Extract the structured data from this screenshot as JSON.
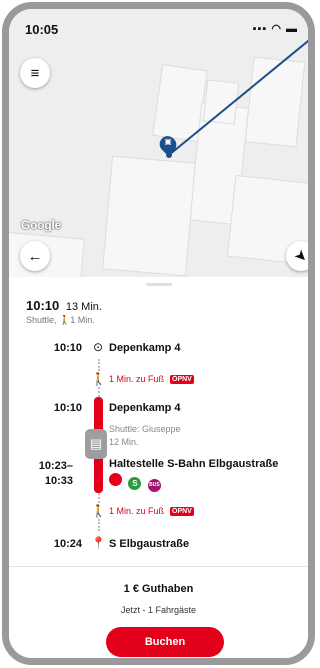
{
  "status": {
    "time": "10:05",
    "icons": "▪▪▪ ◠ ▬"
  },
  "map": {
    "attribution": "Google"
  },
  "summary": {
    "departure": "10:10",
    "duration": "13 Min.",
    "modes": "Shuttle, 🚶1 Min."
  },
  "itinerary": {
    "stop1": {
      "time": "10:10",
      "name": "Depenkamp 4"
    },
    "walk1": {
      "text": "1 Min. zu Fuß",
      "tag": "ÖPNV"
    },
    "stop2": {
      "time": "10:10",
      "name": "Depenkamp 4"
    },
    "shuttle_driver": "Shuttle: Giuseppe",
    "shuttle_duration": "12 Min.",
    "stop3": {
      "time_start": "10:23–",
      "time_end": "10:33",
      "name": "Haltestelle S-Bahn Elbgaustraße"
    },
    "lines": [
      "",
      "S",
      "BUS"
    ],
    "walk2": {
      "text": "1 Min. zu Fuß",
      "tag": "ÖPNV"
    },
    "stop4": {
      "time": "10:24",
      "name": "S Elbgaustraße"
    }
  },
  "booking": {
    "credit": "1 € Guthaben",
    "passengers": "Jetzt - 1 Fahrgäste",
    "button": "Buchen"
  },
  "colors": {
    "accent": "#e2001a",
    "route_line": "#1f4e8c"
  },
  "icons": [
    "menu-icon",
    "back-arrow-icon",
    "locate-icon",
    "shuttle-pin-icon",
    "walk-icon",
    "origin-icon",
    "destination-pin-icon"
  ]
}
